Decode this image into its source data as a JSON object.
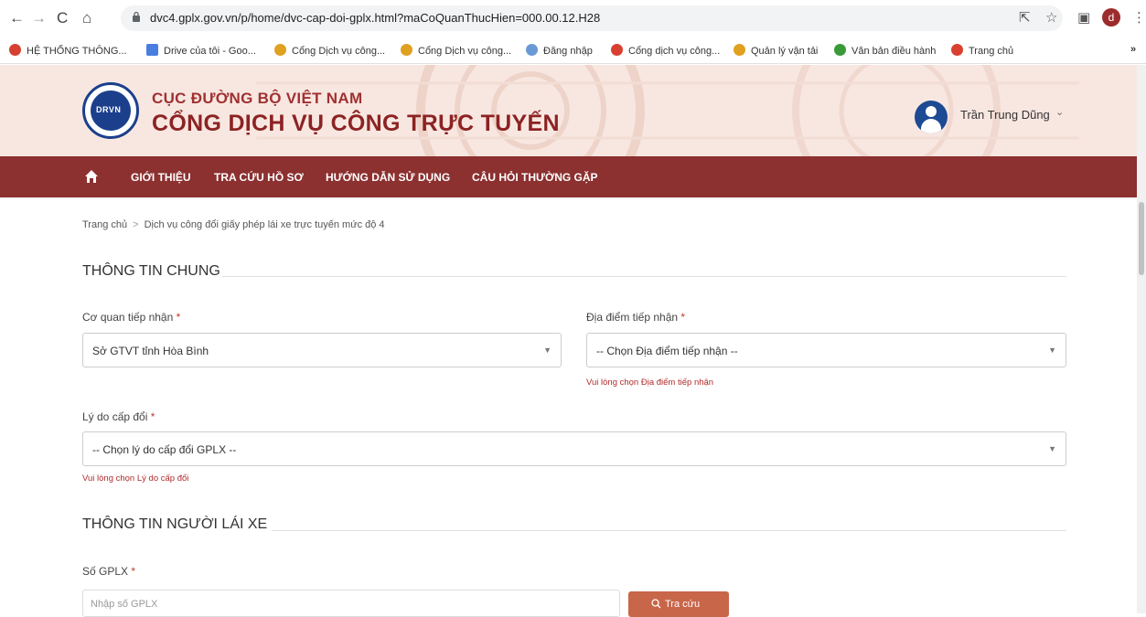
{
  "browser": {
    "url": "dvc4.gplx.gov.vn/p/home/dvc-cap-doi-gplx.html?maCoQuanThucHien=000.00.12.H28",
    "profile_initial": "d",
    "bookmarks": [
      {
        "label": "HỆ THỐNG THÔNG...",
        "color": "#d5402f"
      },
      {
        "label": "Drive của tôi - Goo...",
        "color": "#4a7de0"
      },
      {
        "label": "Cổng Dịch vụ công...",
        "color": "#e0a020"
      },
      {
        "label": "Cổng Dịch vụ công...",
        "color": "#e0a020"
      },
      {
        "label": "Đăng nhập",
        "color": "#6a9ad6"
      },
      {
        "label": "Cổng dịch vụ công...",
        "color": "#d94030"
      },
      {
        "label": "Quản lý vận tải",
        "color": "#e0a020"
      },
      {
        "label": "Văn bản điều hành",
        "color": "#3a9a3a"
      },
      {
        "label": "Trang chủ",
        "color": "#d94030"
      }
    ],
    "more_label": "»"
  },
  "header": {
    "logo_text": "DRVN",
    "org_name": "CỤC ĐƯỜNG BỘ VIỆT NAM",
    "portal_name": "CỔNG DỊCH VỤ CÔNG TRỰC TUYẾN",
    "user_name": "Trần Trung Dũng"
  },
  "nav": {
    "items": [
      "GIỚI THIỆU",
      "TRA CỨU HỒ SƠ",
      "HƯỚNG DẪN SỬ DỤNG",
      "CÂU HỎI THƯỜNG GẶP"
    ]
  },
  "breadcrumb": {
    "home": "Trang chủ",
    "separator": ">",
    "current": "Dịch vụ công đổi giấy phép lái xe trực tuyến mức độ 4"
  },
  "general": {
    "title": "THÔNG TIN CHUNG",
    "agency": {
      "label": "Cơ quan tiếp nhận",
      "required": "*",
      "value": "Sở GTVT tỉnh Hòa Bình"
    },
    "location": {
      "label": "Địa điểm tiếp nhận",
      "required": "*",
      "value": "-- Chọn Địa điểm tiếp nhận --",
      "error": "Vui lòng chọn Địa điểm tiếp nhận"
    },
    "reason": {
      "label": "Lý do cấp đổi",
      "required": "*",
      "value": "-- Chọn lý do cấp đổi GPLX --",
      "error": "Vui lòng chọn Lý do cấp đổi"
    }
  },
  "driver": {
    "title": "THÔNG TIN NGƯỜI LÁI XE",
    "license": {
      "label": "Số GPLX",
      "required": "*",
      "placeholder": "Nhập số GPLX"
    },
    "search_label": "Tra cứu"
  },
  "colors": {
    "nav_bg": "#8c3030",
    "header_bg": "#f8e7e1",
    "button_bg": "#c8664a",
    "error": "#b02a2a"
  }
}
